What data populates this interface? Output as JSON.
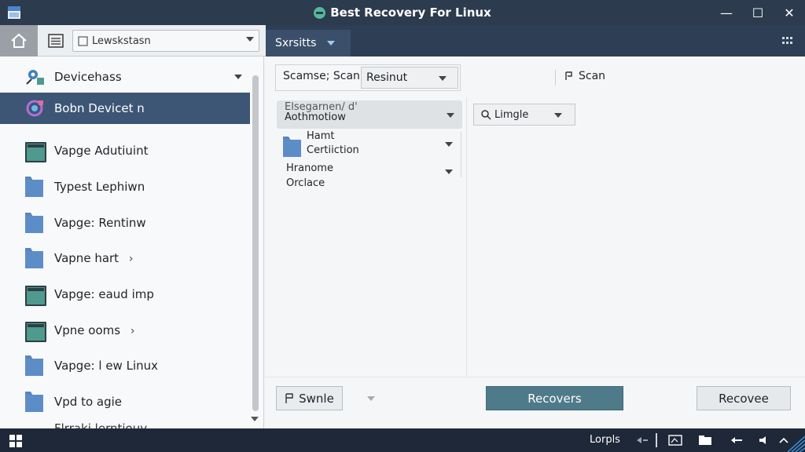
{
  "window": {
    "title": "Best Recovery For Linux",
    "controls": {
      "minimize": "—",
      "maximize": "☐",
      "close": "✕"
    }
  },
  "toolbar": {
    "path_value": "Lewskstasn",
    "tab_label": "Sxrsitts"
  },
  "sidebar": {
    "items": [
      {
        "label": "Devicehass",
        "icon": "devices-icon",
        "has_dropdown": true
      },
      {
        "label": "Bobn Devicet n",
        "icon": "device-gear-icon",
        "selected": true
      },
      {
        "label": "Vapge Adutiuint",
        "icon": "drive-icon"
      },
      {
        "label": "Typest Lephiwn",
        "icon": "folder-icon"
      },
      {
        "label": "Vapge: Rentinw",
        "icon": "folder-icon"
      },
      {
        "label": "Vapne hart",
        "icon": "folder-icon",
        "chevron": "›"
      },
      {
        "label": "Vapge: eaud imp",
        "icon": "drive-icon"
      },
      {
        "label": "Vpne ooms",
        "icon": "drive-icon",
        "chevron": "›"
      },
      {
        "label": "Vapge: l ew Linux",
        "icon": "folder-icon"
      },
      {
        "label": "Vpd to agie",
        "icon": "folder-icon"
      }
    ],
    "partial_item": "Flrraki lerntiouv"
  },
  "main": {
    "scan_label": "Scamse; Scan",
    "result_select": "Resinut",
    "scan_link": "Scan",
    "group": {
      "sub_label": "Elsegarnen/ d'",
      "label": "Aothmotiow"
    },
    "tree": [
      {
        "line1": "Hamt",
        "line2": "Certiiction",
        "icon": "folder-icon"
      },
      {
        "line1": "Hranome",
        "line2": "Orclace"
      }
    ],
    "mode_select": "Limgle"
  },
  "buttons": {
    "swile": "Swnle",
    "recovers": "Recovers",
    "recovee": "Recovee"
  },
  "taskbar": {
    "label": "Lorpls"
  },
  "colors": {
    "titlebar": "#2d3b4e",
    "selected_item": "#3d5676",
    "primary_button": "#4f7a8a",
    "taskbar": "#1e2838"
  }
}
